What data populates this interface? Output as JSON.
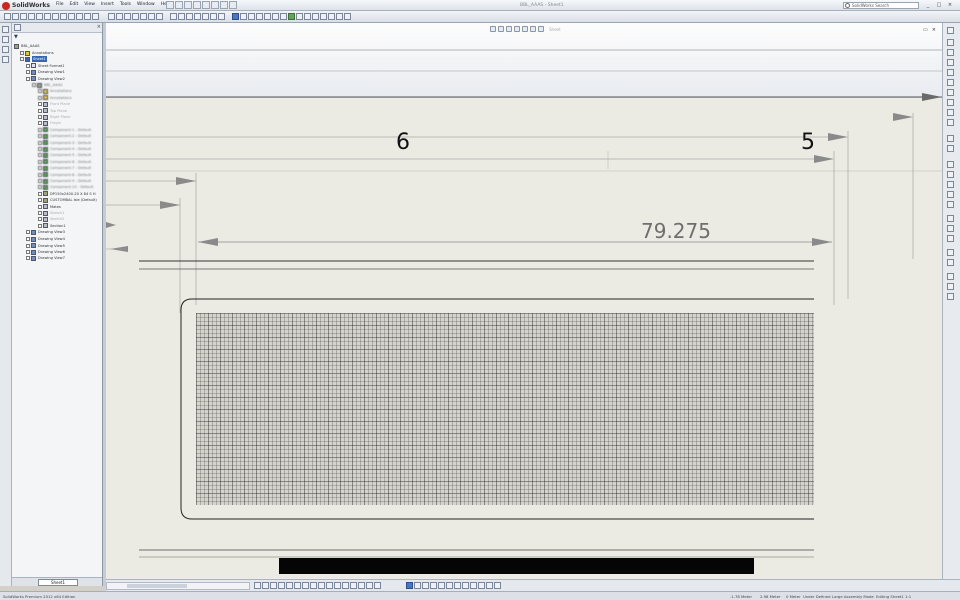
{
  "app": {
    "name": "SolidWorks",
    "document_title": "BBL_AAAS - Sheet1",
    "search_placeholder": "SolidWorks Search"
  },
  "menu": [
    "File",
    "Edit",
    "View",
    "Insert",
    "Tools",
    "Window",
    "Help"
  ],
  "window_buttons": [
    "_",
    "□",
    "×"
  ],
  "feature_tree": {
    "root": "BBL_AAAS",
    "nodes": [
      {
        "label": "Annotations",
        "icon": "yellow",
        "indent": 1,
        "style": ""
      },
      {
        "label": "Sheet1",
        "icon": "sel",
        "indent": 1,
        "style": "sel"
      },
      {
        "label": "Sheet Format1",
        "icon": "sheet",
        "indent": 2,
        "style": ""
      },
      {
        "label": "Drawing View1",
        "icon": "view",
        "indent": 2,
        "style": ""
      },
      {
        "label": "Drawing View2",
        "icon": "view",
        "indent": 2,
        "style": ""
      },
      {
        "label": "BBL_AAAS",
        "icon": "part",
        "indent": 3,
        "style": "blur"
      },
      {
        "label": "Annotations",
        "icon": "yellow",
        "indent": 4,
        "style": "blur"
      },
      {
        "label": "Annotations",
        "icon": "yellow",
        "indent": 4,
        "style": "blur"
      },
      {
        "label": "Front Plane",
        "icon": "gray",
        "indent": 4,
        "style": "faded"
      },
      {
        "label": "Top Plane",
        "icon": "gray",
        "indent": 4,
        "style": "faded"
      },
      {
        "label": "Right Plane",
        "icon": "gray",
        "indent": 4,
        "style": "faded"
      },
      {
        "label": "Origin",
        "icon": "gray",
        "indent": 4,
        "style": "faded"
      },
      {
        "label": "Component-1 - Default",
        "icon": "green",
        "indent": 4,
        "style": "blur"
      },
      {
        "label": "Component-2 - Default",
        "icon": "green",
        "indent": 4,
        "style": "blur"
      },
      {
        "label": "Component-3 - Default",
        "icon": "green",
        "indent": 4,
        "style": "blur"
      },
      {
        "label": "Component-4 - Default",
        "icon": "green",
        "indent": 4,
        "style": "blur"
      },
      {
        "label": "Component-5 - Default",
        "icon": "green",
        "indent": 4,
        "style": "blur"
      },
      {
        "label": "Component-6 - Default",
        "icon": "green",
        "indent": 4,
        "style": "blur"
      },
      {
        "label": "Component-7 - Default",
        "icon": "green",
        "indent": 4,
        "style": "blur"
      },
      {
        "label": "Component-8 - Default",
        "icon": "green",
        "indent": 4,
        "style": "blur"
      },
      {
        "label": "Component-9 - Default",
        "icon": "green",
        "indent": 4,
        "style": "blur"
      },
      {
        "label": "Component-10 - Default",
        "icon": "green",
        "indent": 4,
        "style": "blur"
      },
      {
        "label": "DP150x2400-20 X 84 S H",
        "icon": "part",
        "indent": 4,
        "style": ""
      },
      {
        "label": "CUSTOMBAL Isle (Default)",
        "icon": "part",
        "indent": 4,
        "style": ""
      },
      {
        "label": "Mates",
        "icon": "gray",
        "indent": 4,
        "style": ""
      },
      {
        "label": "Sketch1",
        "icon": "gray",
        "indent": 4,
        "style": "faded"
      },
      {
        "label": "Sketch2",
        "icon": "gray",
        "indent": 4,
        "style": "faded"
      },
      {
        "label": "Section1",
        "icon": "gray",
        "indent": 4,
        "style": ""
      },
      {
        "label": "Drawing View3",
        "icon": "view",
        "indent": 2,
        "style": ""
      },
      {
        "label": "Drawing View4",
        "icon": "view",
        "indent": 2,
        "style": ""
      },
      {
        "label": "Drawing View5",
        "icon": "view",
        "indent": 2,
        "style": ""
      },
      {
        "label": "Drawing View6",
        "icon": "view",
        "indent": 2,
        "style": ""
      },
      {
        "label": "Drawing View7",
        "icon": "view",
        "indent": 2,
        "style": ""
      }
    ],
    "sheet_tab": "Sheet1"
  },
  "drawing": {
    "dim_top_left": "6",
    "dim_top_right": "5",
    "dim_overall": "79.275"
  },
  "headsup_label": "Sheet",
  "status": {
    "left": "SolidWorks Premium 2012 x64 Edition",
    "coords": [
      "-1.78 Meter",
      "2.98 Meter",
      "0 Meter"
    ],
    "state": "Under Defined",
    "mode": "Large Assembly Mode",
    "sheet": "Editing Sheet1",
    "scale": "1:1"
  }
}
